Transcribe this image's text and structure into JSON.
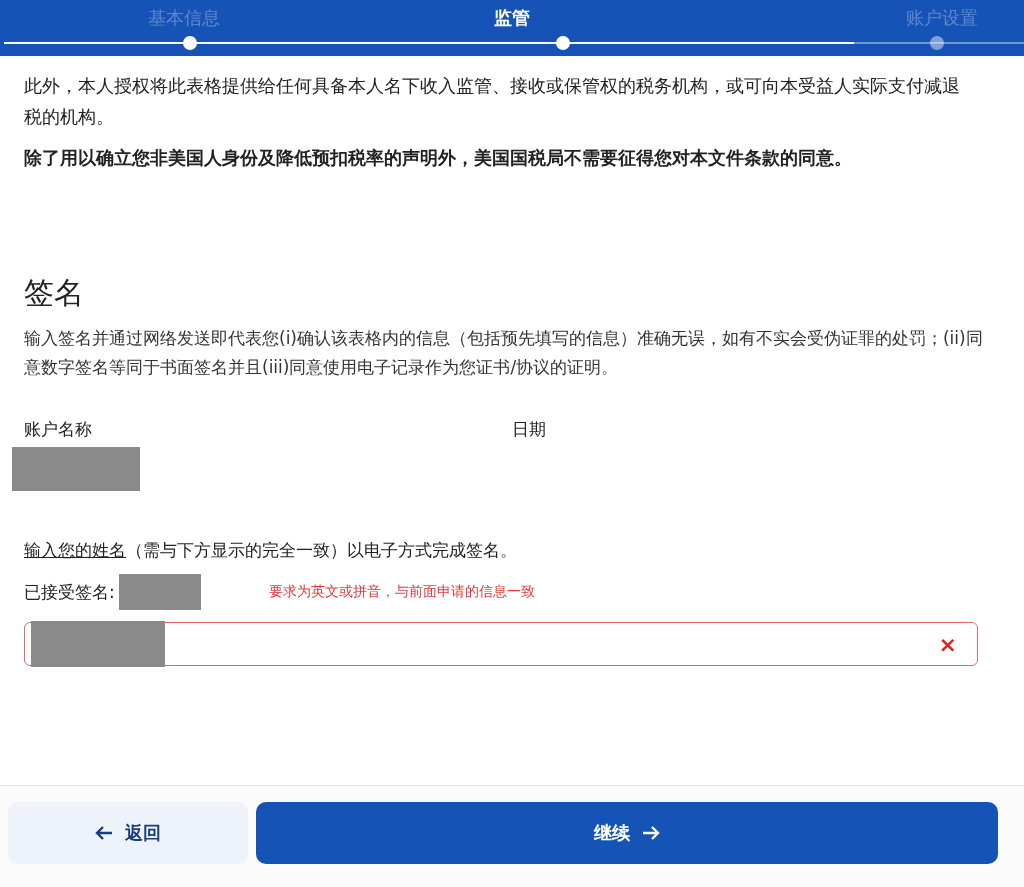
{
  "stepper": {
    "steps": [
      {
        "label": "基本信息",
        "selected": false,
        "completed": true
      },
      {
        "label": "监管",
        "selected": true,
        "completed": true
      },
      {
        "label": "账户设置",
        "selected": false,
        "completed": false
      }
    ]
  },
  "intro_paragraphs": [
    {
      "text": "此外，本人授权将此表格提供给任何具备本人名下收入监管、接收或保管权的税务机构，或可向本受益人实际支付减退税的机构。",
      "bold": false
    },
    {
      "text": "除了用以确立您非美国人身份及降低预扣税率的声明外，美国国税局不需要征得您对本文件条款的同意。",
      "bold": true
    }
  ],
  "signature": {
    "heading": "签名",
    "description": "输入签名并通过网络发送即代表您(i)确认该表格内的信息（包括预先填写的信息）准确无误，如有不实会受伪证罪的处罚；(ii)同意数字签名等同于书面签名并且(iii)同意使用电子记录作为您证书/协议的证明。",
    "account_name_label": "账户名称",
    "date_label": "日期",
    "instruction_link": "输入您的姓名",
    "instruction_rest": "（需与下方显示的完全一致）以电子方式完成签名。",
    "accepted_label": "已接受签名:",
    "annotation": "要求为英文或拼音，与前面申请的信息一致",
    "field": {
      "error": true,
      "clear_button": "×"
    }
  },
  "buttons": {
    "back": "返回",
    "continue": "继续"
  }
}
